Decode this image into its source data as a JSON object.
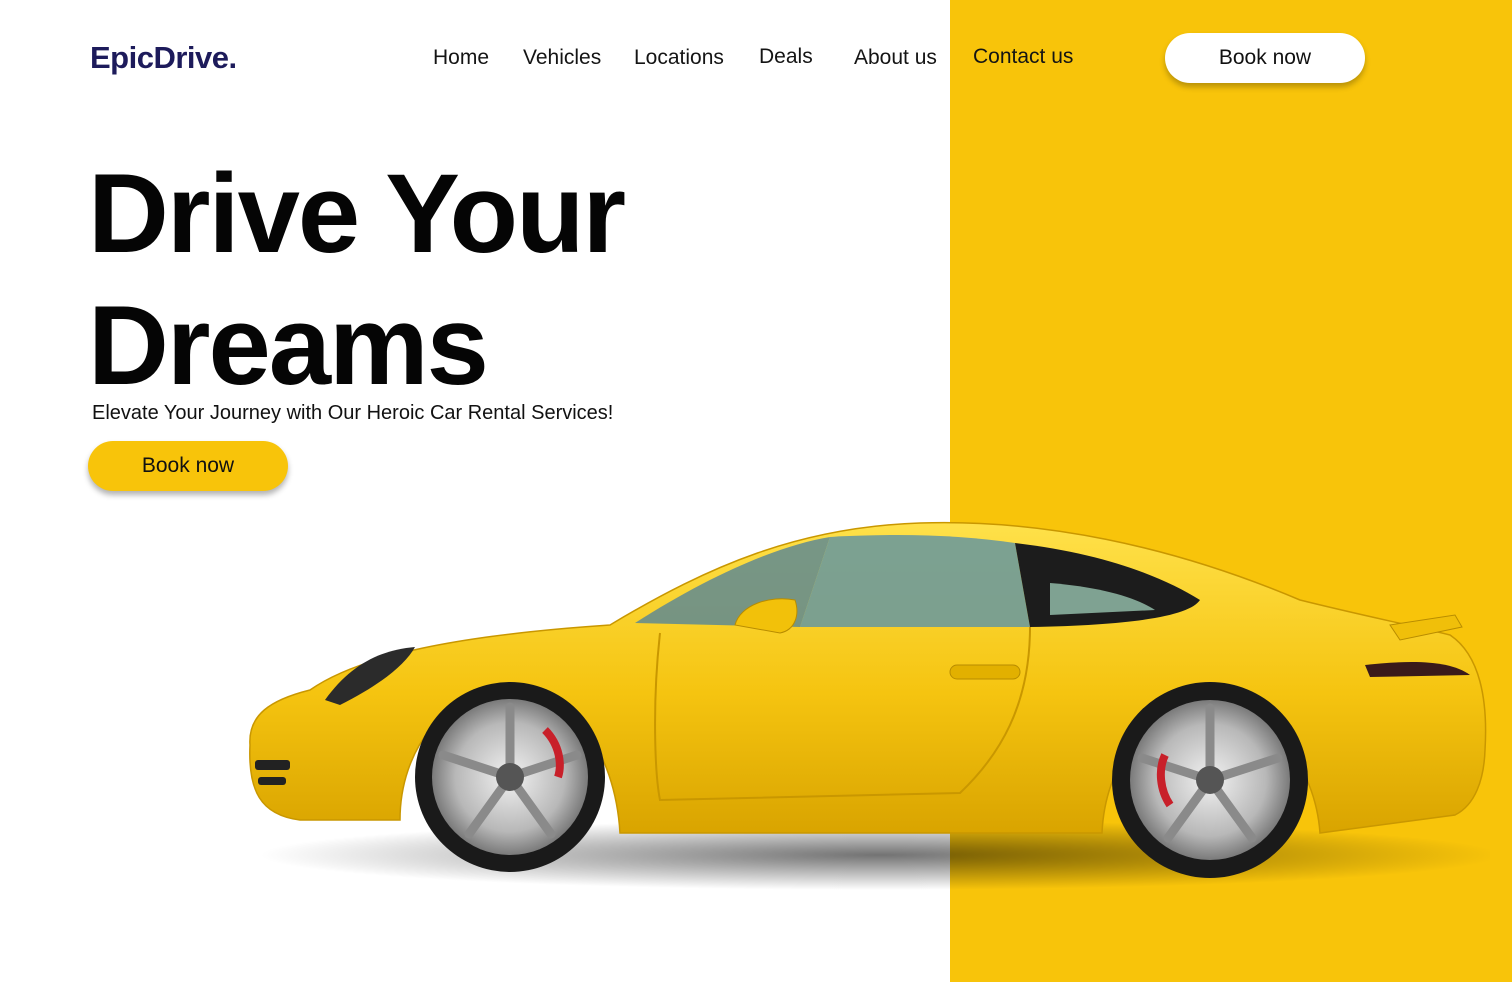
{
  "brand": {
    "logo_text": "EpicDrive."
  },
  "nav": {
    "items": [
      {
        "label": "Home"
      },
      {
        "label": "Vehicles"
      },
      {
        "label": "Locations"
      },
      {
        "label": "Deals"
      },
      {
        "label": "About us"
      },
      {
        "label": "Contact us"
      }
    ],
    "cta_label": "Book now"
  },
  "hero": {
    "title_line1": "Drive Your",
    "title_line2": "Dreams",
    "subtitle": "Elevate Your Journey with Our Heroic Car Rental Services!",
    "cta_label": "Book now",
    "image_subject": "yellow-sports-car"
  },
  "colors": {
    "accent_yellow": "#f8c40a",
    "logo_navy": "#1d1b5b",
    "background": "#ffffff",
    "text": "#050505"
  }
}
